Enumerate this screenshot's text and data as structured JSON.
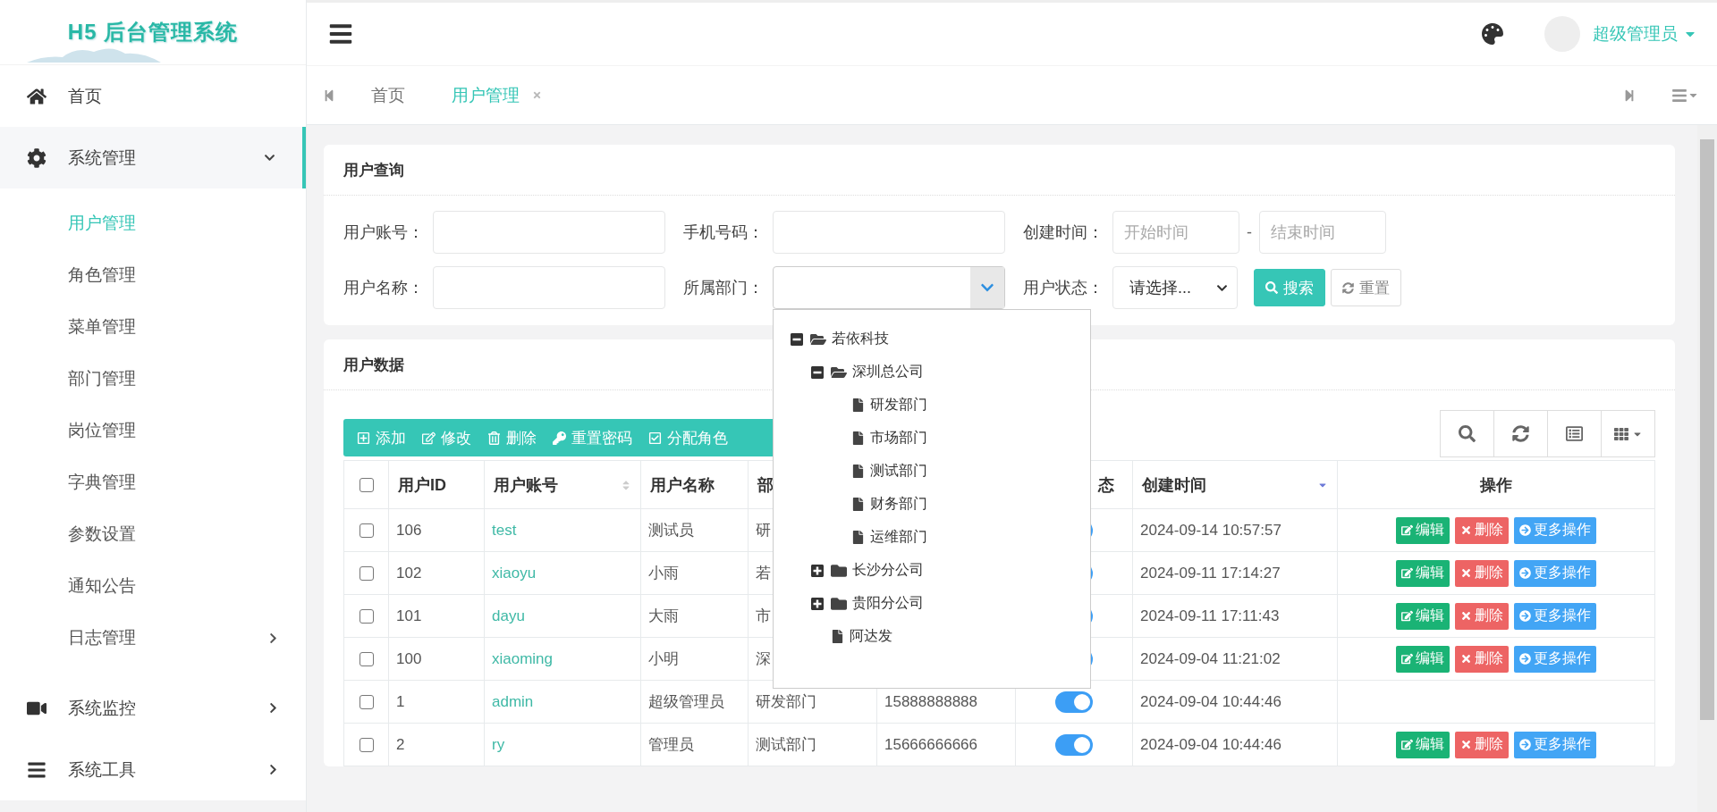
{
  "brand": {
    "title": "H5 后台管理系统"
  },
  "sidebar": {
    "items": [
      {
        "label": "首页",
        "selected": false
      },
      {
        "label": "系统管理",
        "selected": true,
        "expanded": true,
        "children": [
          {
            "label": "用户管理",
            "selected": true
          },
          {
            "label": "角色管理",
            "selected": false
          },
          {
            "label": "菜单管理",
            "selected": false
          },
          {
            "label": "部门管理",
            "selected": false
          },
          {
            "label": "岗位管理",
            "selected": false
          },
          {
            "label": "字典管理",
            "selected": false
          },
          {
            "label": "参数设置",
            "selected": false
          },
          {
            "label": "通知公告",
            "selected": false
          },
          {
            "label": "日志管理",
            "selected": false,
            "expanded": false
          }
        ]
      },
      {
        "label": "系统监控",
        "selected": false,
        "expanded": false
      },
      {
        "label": "系统工具",
        "selected": false,
        "expanded": false
      }
    ]
  },
  "header": {
    "user": "超级管理员"
  },
  "tabs": [
    {
      "label": "首页",
      "selected": false,
      "closable": false
    },
    {
      "label": "用户管理",
      "selected": true,
      "closable": true
    }
  ],
  "query": {
    "title": "用户查询",
    "fields": [
      {
        "kind": "text",
        "label": "用户账号："
      },
      {
        "kind": "text",
        "label": "手机号码："
      },
      {
        "kind": "daterange",
        "label": "创建时间：",
        "placeholder": "开始时间",
        "separator": "-",
        "placeholder_end": "结束时间"
      },
      {
        "kind": "text",
        "label": "用户名称："
      },
      {
        "kind": "tree-select",
        "label": "所属部门：",
        "expanded": true,
        "tree": [
          {
            "kind": "folder",
            "label": "若依科技",
            "expanded": true,
            "children": [
              {
                "kind": "folder",
                "label": "深圳总公司",
                "expanded": true,
                "children": [
                  {
                    "kind": "file",
                    "label": "研发部门"
                  },
                  {
                    "kind": "file",
                    "label": "市场部门"
                  },
                  {
                    "kind": "file",
                    "label": "测试部门"
                  },
                  {
                    "kind": "file",
                    "label": "财务部门"
                  },
                  {
                    "kind": "file",
                    "label": "运维部门"
                  }
                ]
              },
              {
                "kind": "folder",
                "label": "长沙分公司",
                "expanded": false
              },
              {
                "kind": "folder",
                "label": "贵阳分公司",
                "expanded": false
              },
              {
                "kind": "file",
                "label": "阿达发"
              }
            ]
          }
        ]
      },
      {
        "kind": "select",
        "label": "用户状态：",
        "value": "请选择..."
      }
    ],
    "buttons": [
      {
        "kind": "primary",
        "label": "搜索"
      },
      {
        "kind": "default",
        "label": "重置"
      }
    ]
  },
  "data": {
    "title": "用户数据",
    "toolbar": [
      {
        "label": "添加"
      },
      {
        "label": "修改"
      },
      {
        "label": "删除"
      },
      {
        "label": "重置密码"
      },
      {
        "label": "分配角色"
      }
    ],
    "table": {
      "header_checked": false,
      "columns": [
        {
          "label": "用户ID"
        },
        {
          "label": "用户账号",
          "sortable": true,
          "sorted": false
        },
        {
          "label": "用户名称"
        },
        {
          "label": "部"
        },
        {},
        {
          "label": "态"
        },
        {
          "label": "创建时间",
          "sortable": true,
          "sorted": true
        },
        {
          "label": "操作"
        }
      ],
      "rows": [
        {
          "checked": false,
          "id": "106",
          "account": "test",
          "name": "测试员",
          "dept": "研",
          "on": true,
          "created": "2024-09-14 10:57:57",
          "actions": [
            {
              "kind": "edit",
              "label": "编辑"
            },
            {
              "kind": "delete",
              "label": "删除"
            },
            {
              "kind": "more",
              "label": "更多操作"
            }
          ]
        },
        {
          "checked": false,
          "id": "102",
          "account": "xiaoyu",
          "name": "小雨",
          "dept": "若",
          "on": true,
          "created": "2024-09-11 17:14:27",
          "actions": [
            {
              "kind": "edit",
              "label": "编辑"
            },
            {
              "kind": "delete",
              "label": "删除"
            },
            {
              "kind": "more",
              "label": "更多操作"
            }
          ]
        },
        {
          "checked": false,
          "id": "101",
          "account": "dayu",
          "name": "大雨",
          "dept": "市",
          "on": true,
          "created": "2024-09-11 17:11:43",
          "actions": [
            {
              "kind": "edit",
              "label": "编辑"
            },
            {
              "kind": "delete",
              "label": "删除"
            },
            {
              "kind": "more",
              "label": "更多操作"
            }
          ]
        },
        {
          "checked": false,
          "id": "100",
          "account": "xiaoming",
          "name": "小明",
          "dept": "深",
          "on": true,
          "created": "2024-09-04 11:21:02",
          "actions": [
            {
              "kind": "edit",
              "label": "编辑"
            },
            {
              "kind": "delete",
              "label": "删除"
            },
            {
              "kind": "more",
              "label": "更多操作"
            }
          ]
        },
        {
          "checked": false,
          "id": "1",
          "account": "admin",
          "name": "超级管理员",
          "dept": "研发部门",
          "phone": "15888888888",
          "on": true,
          "created": "2024-09-04 10:44:46"
        },
        {
          "checked": false,
          "id": "2",
          "account": "ry",
          "name": "管理员",
          "dept": "测试部门",
          "phone": "15666666666",
          "on": true,
          "created": "2024-09-04 10:44:46",
          "actions": [
            {
              "kind": "edit",
              "label": "编辑"
            },
            {
              "kind": "delete",
              "label": "删除"
            },
            {
              "kind": "more",
              "label": "更多操作"
            }
          ]
        }
      ]
    }
  }
}
